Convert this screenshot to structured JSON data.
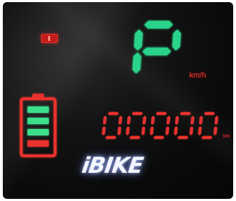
{
  "gear": {
    "value": "P",
    "color": "#2bd38a"
  },
  "speed": {
    "unit": "km/h"
  },
  "battery": {
    "level_bars": 3,
    "total_bars": 4,
    "bar_color": "#3ee08a",
    "frame_color": "#e8322e"
  },
  "odometer": {
    "reading": "00000",
    "unit": "km",
    "color": "#e8322e"
  },
  "indicator": {
    "icon": "warning-indicator-icon",
    "color": "#e8322e"
  },
  "brand": {
    "logo_text": "iBIKE"
  }
}
